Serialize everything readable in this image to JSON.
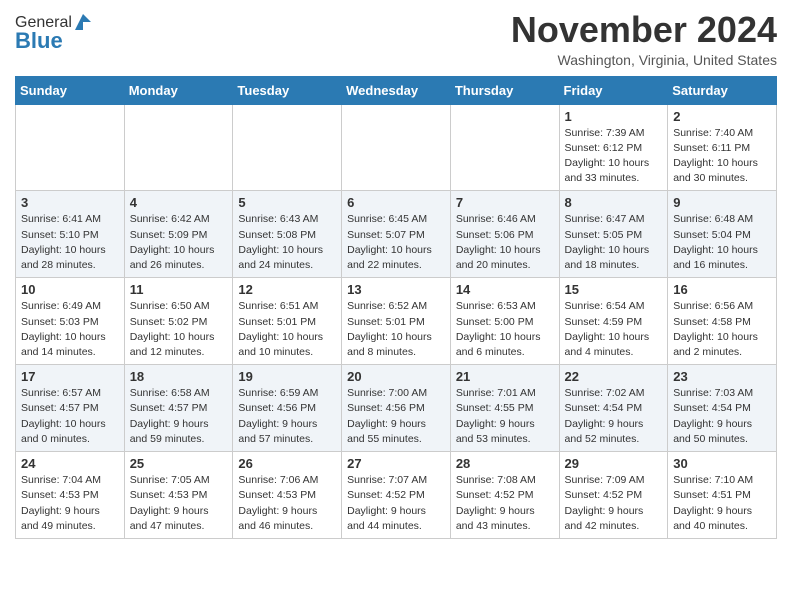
{
  "header": {
    "logo_general": "General",
    "logo_blue": "Blue",
    "month_title": "November 2024",
    "location": "Washington, Virginia, United States"
  },
  "weekdays": [
    "Sunday",
    "Monday",
    "Tuesday",
    "Wednesday",
    "Thursday",
    "Friday",
    "Saturday"
  ],
  "weeks": [
    [
      {
        "day": "",
        "info": ""
      },
      {
        "day": "",
        "info": ""
      },
      {
        "day": "",
        "info": ""
      },
      {
        "day": "",
        "info": ""
      },
      {
        "day": "",
        "info": ""
      },
      {
        "day": "1",
        "info": "Sunrise: 7:39 AM\nSunset: 6:12 PM\nDaylight: 10 hours\nand 33 minutes."
      },
      {
        "day": "2",
        "info": "Sunrise: 7:40 AM\nSunset: 6:11 PM\nDaylight: 10 hours\nand 30 minutes."
      }
    ],
    [
      {
        "day": "3",
        "info": "Sunrise: 6:41 AM\nSunset: 5:10 PM\nDaylight: 10 hours\nand 28 minutes."
      },
      {
        "day": "4",
        "info": "Sunrise: 6:42 AM\nSunset: 5:09 PM\nDaylight: 10 hours\nand 26 minutes."
      },
      {
        "day": "5",
        "info": "Sunrise: 6:43 AM\nSunset: 5:08 PM\nDaylight: 10 hours\nand 24 minutes."
      },
      {
        "day": "6",
        "info": "Sunrise: 6:45 AM\nSunset: 5:07 PM\nDaylight: 10 hours\nand 22 minutes."
      },
      {
        "day": "7",
        "info": "Sunrise: 6:46 AM\nSunset: 5:06 PM\nDaylight: 10 hours\nand 20 minutes."
      },
      {
        "day": "8",
        "info": "Sunrise: 6:47 AM\nSunset: 5:05 PM\nDaylight: 10 hours\nand 18 minutes."
      },
      {
        "day": "9",
        "info": "Sunrise: 6:48 AM\nSunset: 5:04 PM\nDaylight: 10 hours\nand 16 minutes."
      }
    ],
    [
      {
        "day": "10",
        "info": "Sunrise: 6:49 AM\nSunset: 5:03 PM\nDaylight: 10 hours\nand 14 minutes."
      },
      {
        "day": "11",
        "info": "Sunrise: 6:50 AM\nSunset: 5:02 PM\nDaylight: 10 hours\nand 12 minutes."
      },
      {
        "day": "12",
        "info": "Sunrise: 6:51 AM\nSunset: 5:01 PM\nDaylight: 10 hours\nand 10 minutes."
      },
      {
        "day": "13",
        "info": "Sunrise: 6:52 AM\nSunset: 5:01 PM\nDaylight: 10 hours\nand 8 minutes."
      },
      {
        "day": "14",
        "info": "Sunrise: 6:53 AM\nSunset: 5:00 PM\nDaylight: 10 hours\nand 6 minutes."
      },
      {
        "day": "15",
        "info": "Sunrise: 6:54 AM\nSunset: 4:59 PM\nDaylight: 10 hours\nand 4 minutes."
      },
      {
        "day": "16",
        "info": "Sunrise: 6:56 AM\nSunset: 4:58 PM\nDaylight: 10 hours\nand 2 minutes."
      }
    ],
    [
      {
        "day": "17",
        "info": "Sunrise: 6:57 AM\nSunset: 4:57 PM\nDaylight: 10 hours\nand 0 minutes."
      },
      {
        "day": "18",
        "info": "Sunrise: 6:58 AM\nSunset: 4:57 PM\nDaylight: 9 hours\nand 59 minutes."
      },
      {
        "day": "19",
        "info": "Sunrise: 6:59 AM\nSunset: 4:56 PM\nDaylight: 9 hours\nand 57 minutes."
      },
      {
        "day": "20",
        "info": "Sunrise: 7:00 AM\nSunset: 4:56 PM\nDaylight: 9 hours\nand 55 minutes."
      },
      {
        "day": "21",
        "info": "Sunrise: 7:01 AM\nSunset: 4:55 PM\nDaylight: 9 hours\nand 53 minutes."
      },
      {
        "day": "22",
        "info": "Sunrise: 7:02 AM\nSunset: 4:54 PM\nDaylight: 9 hours\nand 52 minutes."
      },
      {
        "day": "23",
        "info": "Sunrise: 7:03 AM\nSunset: 4:54 PM\nDaylight: 9 hours\nand 50 minutes."
      }
    ],
    [
      {
        "day": "24",
        "info": "Sunrise: 7:04 AM\nSunset: 4:53 PM\nDaylight: 9 hours\nand 49 minutes."
      },
      {
        "day": "25",
        "info": "Sunrise: 7:05 AM\nSunset: 4:53 PM\nDaylight: 9 hours\nand 47 minutes."
      },
      {
        "day": "26",
        "info": "Sunrise: 7:06 AM\nSunset: 4:53 PM\nDaylight: 9 hours\nand 46 minutes."
      },
      {
        "day": "27",
        "info": "Sunrise: 7:07 AM\nSunset: 4:52 PM\nDaylight: 9 hours\nand 44 minutes."
      },
      {
        "day": "28",
        "info": "Sunrise: 7:08 AM\nSunset: 4:52 PM\nDaylight: 9 hours\nand 43 minutes."
      },
      {
        "day": "29",
        "info": "Sunrise: 7:09 AM\nSunset: 4:52 PM\nDaylight: 9 hours\nand 42 minutes."
      },
      {
        "day": "30",
        "info": "Sunrise: 7:10 AM\nSunset: 4:51 PM\nDaylight: 9 hours\nand 40 minutes."
      }
    ]
  ]
}
